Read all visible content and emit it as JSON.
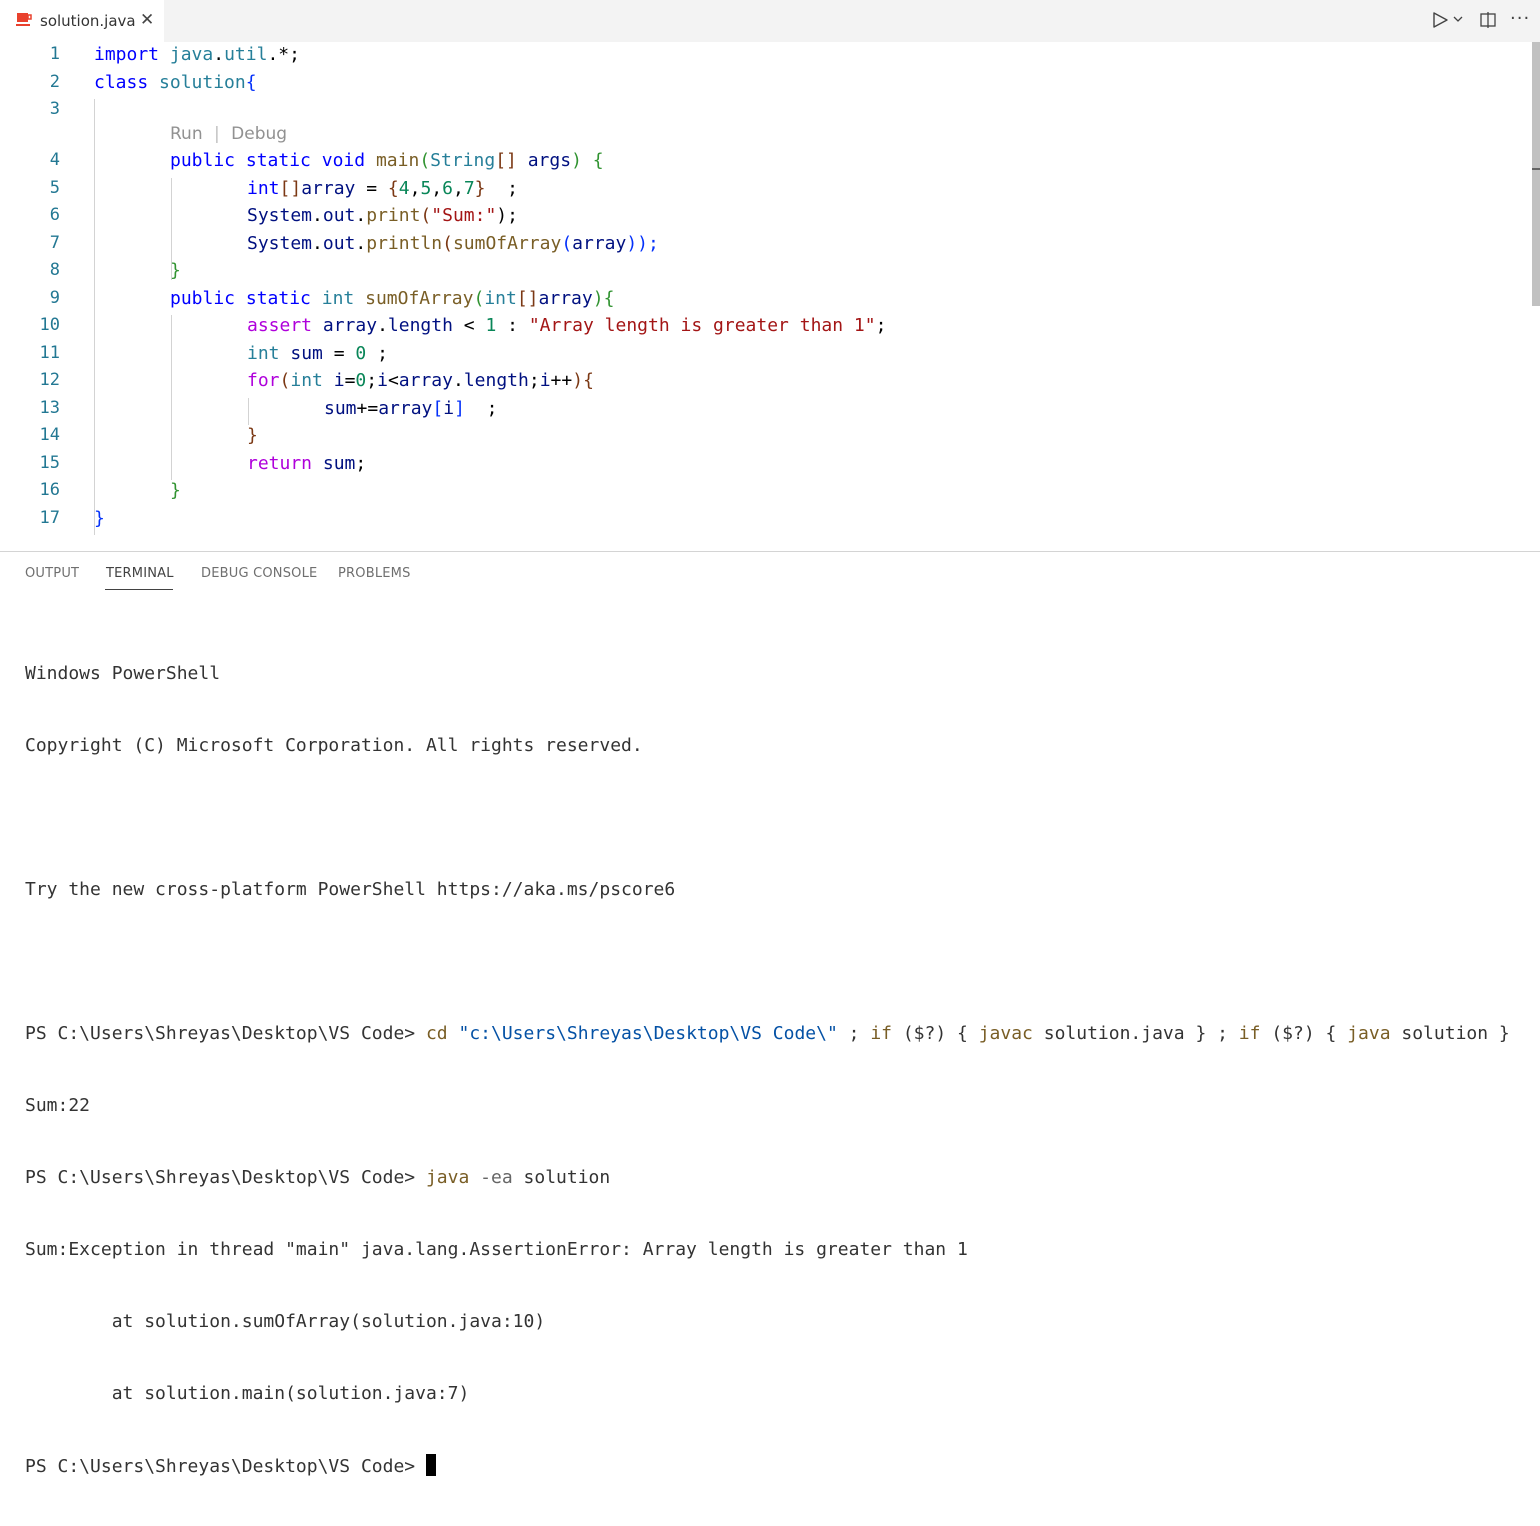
{
  "tab": {
    "filename": "solution.java",
    "close_glyph": "✕",
    "icon": "java-file-icon"
  },
  "actions": {
    "run_icon": "run-icon",
    "dropdown_icon": "chevron-down-icon",
    "split_icon": "split-editor-icon",
    "more_glyph": "···"
  },
  "editor": {
    "codelens": {
      "run": "Run",
      "separator": "|",
      "debug": "Debug"
    },
    "lines": [
      {
        "n": "1"
      },
      {
        "n": "2"
      },
      {
        "n": "3"
      },
      {
        "n": "4"
      },
      {
        "n": "5"
      },
      {
        "n": "6"
      },
      {
        "n": "7"
      },
      {
        "n": "8"
      },
      {
        "n": "9"
      },
      {
        "n": "10"
      },
      {
        "n": "11"
      },
      {
        "n": "12"
      },
      {
        "n": "13"
      },
      {
        "n": "14"
      },
      {
        "n": "15"
      },
      {
        "n": "16"
      },
      {
        "n": "17"
      }
    ],
    "code": {
      "l1": [
        "import",
        "java",
        ".",
        "util",
        ".*;"
      ],
      "l2": [
        "class",
        "solution",
        "{"
      ],
      "l4": [
        "public",
        "static",
        "void",
        "main",
        "(",
        "String",
        "[]",
        "args",
        ")",
        "{"
      ],
      "l5": [
        "int",
        "[]",
        "array",
        " = ",
        "{",
        "4",
        ",",
        "5",
        ",",
        "6",
        ",",
        "7",
        "}",
        "  ;"
      ],
      "l6": [
        "System",
        ".",
        "out",
        ".",
        "print",
        "(",
        "\"Sum:\"",
        ");"
      ],
      "l7": [
        "System",
        ".",
        "out",
        ".",
        "println",
        "(",
        "sumOfArray",
        "(",
        "array",
        "));"
      ],
      "l8": [
        "}"
      ],
      "l9": [
        "public",
        "static",
        "int",
        "sumOfArray",
        "(",
        "int",
        "[]",
        "array",
        ")",
        "{"
      ],
      "l10": [
        "assert",
        "array",
        ".",
        "length",
        " < ",
        "1",
        " : ",
        "\"Array length is greater than 1\"",
        ";"
      ],
      "l11": [
        "int",
        "sum",
        " = ",
        "0",
        " ;"
      ],
      "l12": [
        "for",
        "(",
        "int",
        "i",
        "=",
        "0",
        ";",
        "i",
        "<",
        "array",
        ".",
        "length",
        ";",
        "i",
        "++",
        ")",
        "{"
      ],
      "l13": [
        "sum",
        "+=",
        "array",
        "[",
        "i",
        "]",
        "  ;"
      ],
      "l14": [
        "}"
      ],
      "l15": [
        "return",
        "sum",
        ";"
      ],
      "l16": [
        "}"
      ],
      "l17": [
        "}"
      ]
    }
  },
  "panel": {
    "tabs": [
      {
        "label": "OUTPUT"
      },
      {
        "label": "TERMINAL"
      },
      {
        "label": "DEBUG CONSOLE"
      },
      {
        "label": "PROBLEMS"
      }
    ],
    "active_tab": "TERMINAL"
  },
  "terminal": {
    "l1": "Windows PowerShell",
    "l2": "Copyright (C) Microsoft Corporation. All rights reserved.",
    "l4": "Try the new cross-platform PowerShell https://aka.ms/pscore6",
    "prompt": "PS C:\\Users\\Shreyas\\Desktop\\VS Code> ",
    "cmd1": {
      "cd": "cd",
      "path": "\"c:\\Users\\Shreyas\\Desktop\\VS Code\\\"",
      "sep1": " ; ",
      "if1": "if",
      "cond1": " ($?) { ",
      "javac": "javac",
      "arg1": " solution.java } ; ",
      "if2": "if",
      "cond2": " ($?) { ",
      "java": "java",
      "arg2": " solution }"
    },
    "out1": "Sum:22",
    "cmd2": {
      "java": "java",
      "flag": "-ea",
      "arg": "solution"
    },
    "err1": "Sum:Exception in thread \"main\" java.lang.AssertionError: Array length is greater than 1",
    "err2": "        at solution.sumOfArray(solution.java:10)",
    "err3": "        at solution.main(solution.java:7)"
  },
  "colors": {
    "keyword": "#0000ff",
    "type": "#267f99",
    "control": "#af00db",
    "function": "#795e26",
    "string": "#a31515",
    "number": "#098658",
    "variable": "#001080",
    "line_number": "#237893"
  }
}
